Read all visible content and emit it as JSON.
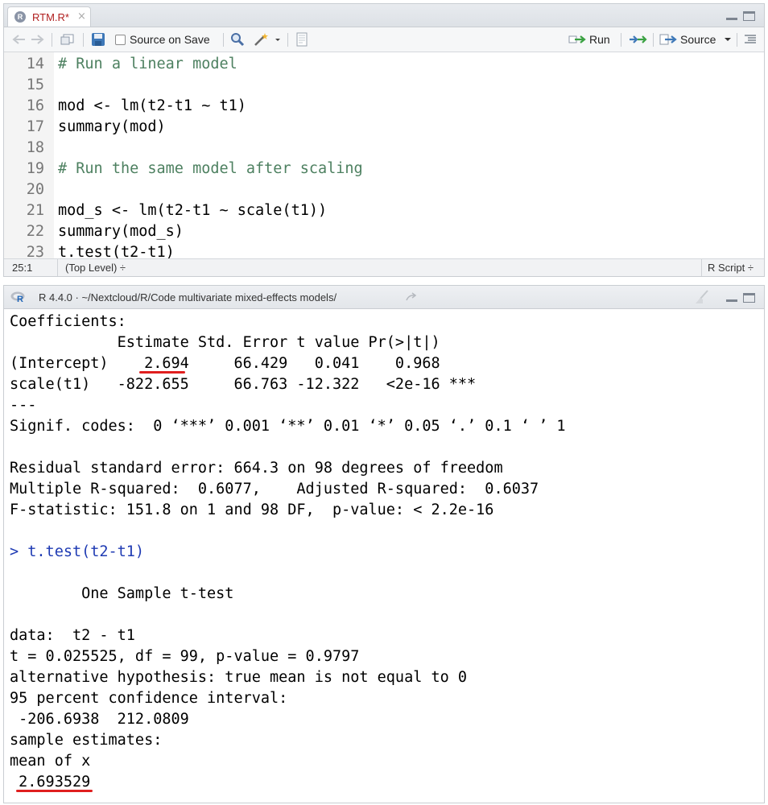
{
  "editor": {
    "tab_label": "RTM.R*",
    "tab_close": "×",
    "r_badge": "R",
    "toolbar": {
      "source_on_save": "Source on Save",
      "run_label": "Run",
      "source_label": "Source"
    },
    "lines": [
      {
        "num": "14",
        "text": "# Run a linear model"
      },
      {
        "num": "15",
        "text": ""
      },
      {
        "num": "16",
        "text": "mod <- lm(t2-t1 ~ t1)"
      },
      {
        "num": "17",
        "text": "summary(mod)"
      },
      {
        "num": "18",
        "text": ""
      },
      {
        "num": "19",
        "text": "# Run the same model after scaling"
      },
      {
        "num": "20",
        "text": ""
      },
      {
        "num": "21",
        "text": "mod_s <- lm(t2-t1 ~ scale(t1))"
      },
      {
        "num": "22",
        "text": "summary(mod_s)"
      },
      {
        "num": "23",
        "text": "t.test(t2-t1)"
      }
    ],
    "status": {
      "position": "25:1",
      "scope": "(Top Level) ÷",
      "filetype": "R Script ÷"
    }
  },
  "console": {
    "header": "R 4.4.0 · ~/Nextcloud/R/Code multivariate mixed-effects models/",
    "lines": [
      "Coefficients:",
      "            Estimate Std. Error t value Pr(>|t|)",
      "(Intercept)    2.694     66.429   0.041    0.968",
      "scale(t1)   -822.655     66.763 -12.322   <2e-16 ***",
      "---",
      "Signif. codes:  0 ‘***’ 0.001 ‘**’ 0.01 ‘*’ 0.05 ‘.’ 0.1 ‘ ’ 1",
      "",
      "Residual standard error: 664.3 on 98 degrees of freedom",
      "Multiple R-squared:  0.6077,    Adjusted R-squared:  0.6037",
      "F-statistic: 151.8 on 1 and 98 DF,  p-value: < 2.2e-16",
      "",
      "> t.test(t2-t1)",
      "",
      "        One Sample t-test",
      "",
      "data:  t2 - t1",
      "t = 0.025525, df = 99, p-value = 0.9797",
      "alternative hypothesis: true mean is not equal to 0",
      "95 percent confidence interval:",
      " -206.6938  212.0809",
      "sample estimates:",
      "mean of x",
      " 2.693529"
    ]
  },
  "colors": {
    "underline": "#e01f1f",
    "prompt": "#1f3bb3",
    "comment": "#4d8060",
    "tab_title": "#b01e1e"
  }
}
